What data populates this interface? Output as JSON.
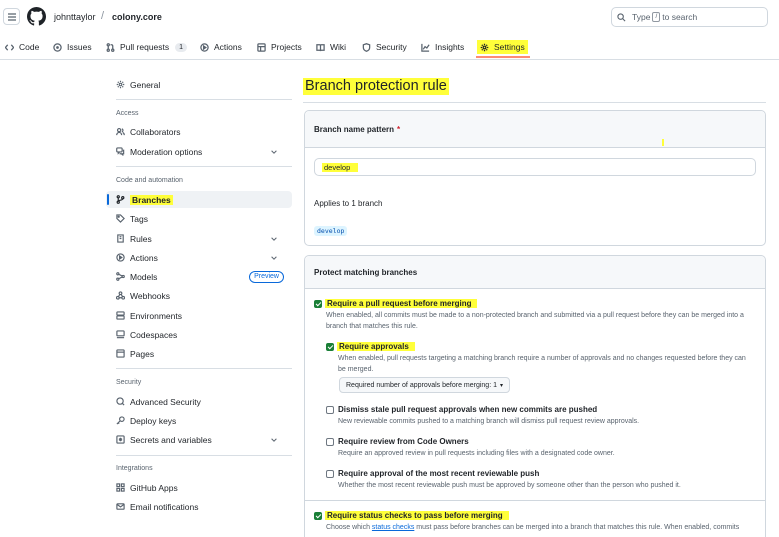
{
  "header": {
    "owner": "johnttaylor",
    "separator": "/",
    "repo": "colony.core",
    "search_prefix": "Type",
    "search_key": "/",
    "search_suffix": "to search"
  },
  "nav": {
    "tabs": [
      {
        "label": "Code",
        "icon": "code-icon"
      },
      {
        "label": "Issues",
        "icon": "issue-icon"
      },
      {
        "label": "Pull requests",
        "icon": "pull-request-icon",
        "count": "1"
      },
      {
        "label": "Actions",
        "icon": "play-icon"
      },
      {
        "label": "Projects",
        "icon": "table-icon"
      },
      {
        "label": "Wiki",
        "icon": "book-icon"
      },
      {
        "label": "Security",
        "icon": "shield-icon"
      },
      {
        "label": "Insights",
        "icon": "graph-icon"
      },
      {
        "label": "Settings",
        "icon": "gear-icon",
        "selected": true
      }
    ]
  },
  "sidebar": {
    "general": "General",
    "section_access": "Access",
    "collaborators": "Collaborators",
    "moderation": "Moderation options",
    "section_code": "Code and automation",
    "branches": "Branches",
    "tags": "Tags",
    "rules": "Rules",
    "actions": "Actions",
    "models": "Models",
    "preview_badge": "Preview",
    "webhooks": "Webhooks",
    "environments": "Environments",
    "codespaces": "Codespaces",
    "pages": "Pages",
    "section_security": "Security",
    "advanced_security": "Advanced Security",
    "deploy_keys": "Deploy keys",
    "secrets": "Secrets and variables",
    "section_integrations": "Integrations",
    "github_apps": "GitHub Apps",
    "email_notifications": "Email notifications"
  },
  "main": {
    "title": "Branch protection rule",
    "branch_pattern_label": "Branch name pattern",
    "required_mark": "*",
    "branch_pattern_value": "develop",
    "applies_to": "Applies to 1 branch",
    "branch_chip": "develop",
    "protect_header": "Protect matching branches",
    "options": {
      "require_pr": {
        "title": "Require a pull request before merging",
        "desc": "When enabled, all commits must be made to a non-protected branch and submitted via a pull request before they can be merged into a branch that matches this rule.",
        "checked": true
      },
      "require_approvals": {
        "title": "Require approvals",
        "desc": "When enabled, pull requests targeting a matching branch require a number of approvals and no changes requested before they can be merged.",
        "checked": true,
        "select_label": "Required number of approvals before merging: 1"
      },
      "dismiss_stale": {
        "title": "Dismiss stale pull request approvals when new commits are pushed",
        "desc": "New reviewable commits pushed to a matching branch will dismiss pull request review approvals.",
        "checked": false
      },
      "code_owners": {
        "title": "Require review from Code Owners",
        "desc": "Require an approved review in pull requests including files with a designated code owner.",
        "checked": false
      },
      "recent_push": {
        "title": "Require approval of the most recent reviewable push",
        "desc": "Whether the most recent reviewable push must be approved by someone other than the person who pushed it.",
        "checked": false
      },
      "status_checks": {
        "title": "Require status checks to pass before merging",
        "desc_pre": "Choose which",
        "desc_link": "status checks",
        "desc_post": "must pass before branches can be merged into a branch that matches this rule. When enabled, commits",
        "checked": true
      }
    }
  }
}
